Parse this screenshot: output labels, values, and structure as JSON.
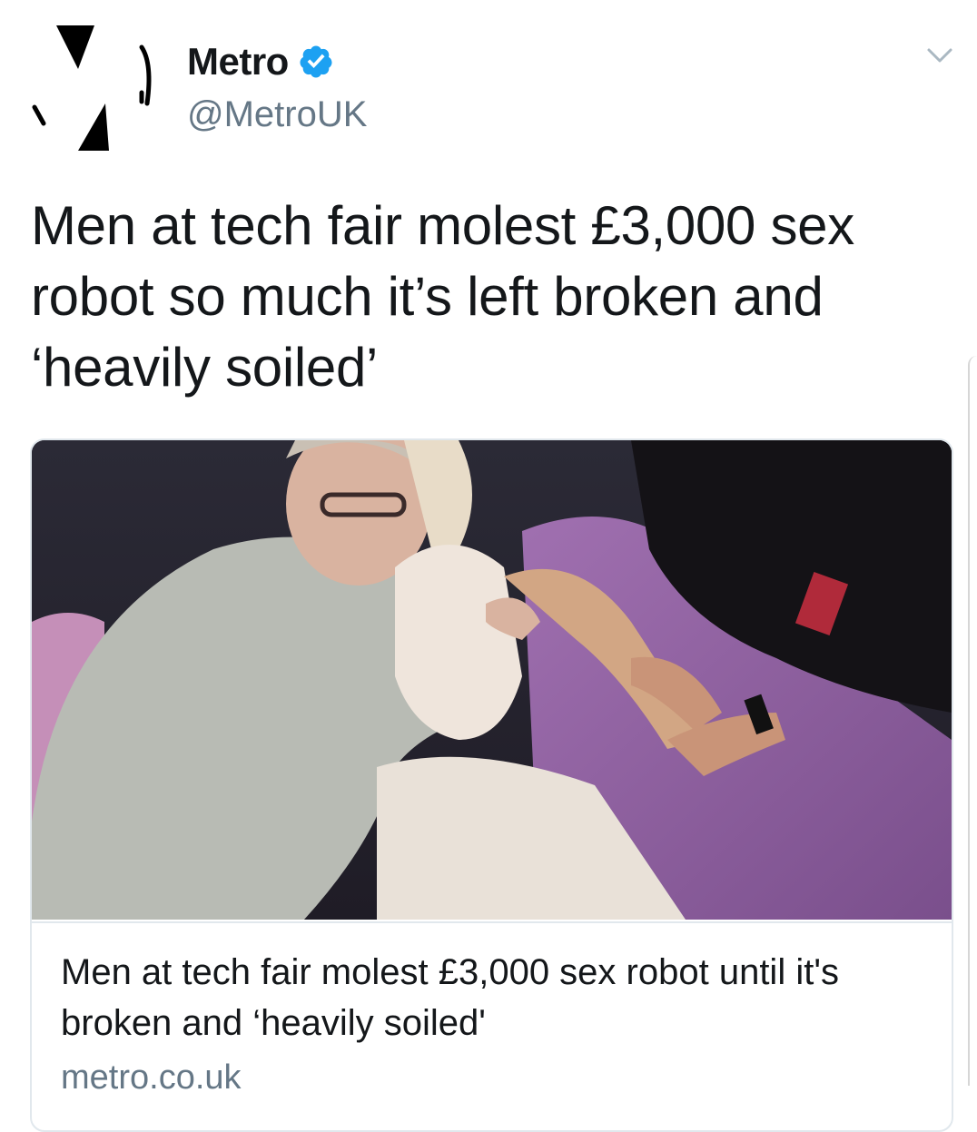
{
  "account": {
    "display_name": "Metro",
    "handle": "@MetroUK",
    "verified": true,
    "avatar_icon": "metro-logo-icon"
  },
  "tweet": {
    "text": "Men at tech fair molest £3,000 sex robot so much it’s left broken and ‘heavily soiled’"
  },
  "card": {
    "image_icon": "article-photo",
    "title": "Men at tech fair molest £3,000 sex robot until it's broken and ‘heavily soiled'",
    "domain": "metro.co.uk"
  },
  "colors": {
    "text": "#14171a",
    "secondary": "#657786",
    "verified_blue": "#1da1f2",
    "border": "#e1e8ed"
  }
}
